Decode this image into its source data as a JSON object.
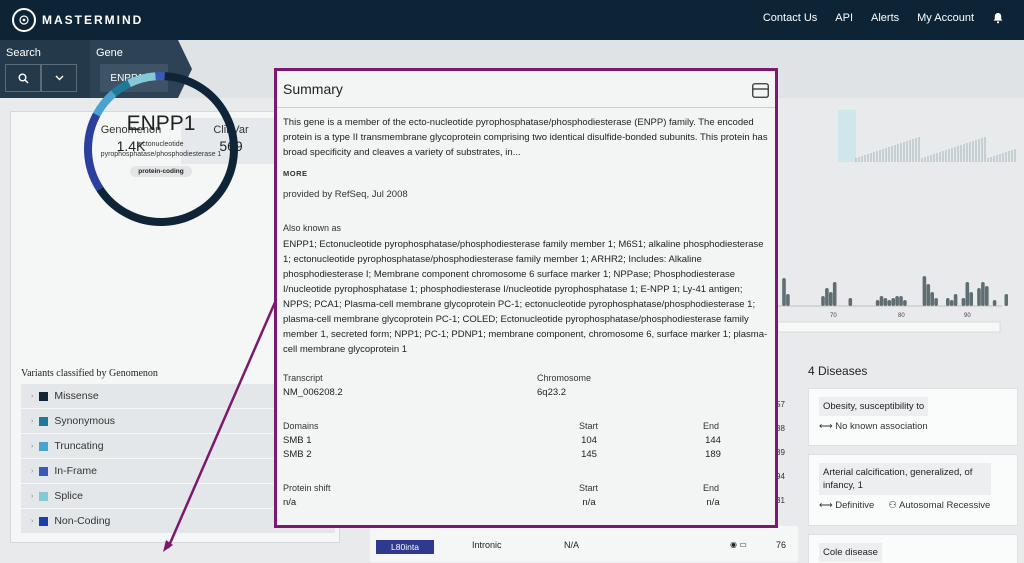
{
  "topbar": {
    "logo_text": "MASTERMIND",
    "nav": [
      "Contact Us",
      "API",
      "Alerts",
      "My Account"
    ]
  },
  "searchbar": {
    "search_label": "Search",
    "gene_label": "Gene",
    "gene_chip": "ENPP1",
    "gene_chip_close": "✕"
  },
  "left_panel": {
    "counts": [
      {
        "label": "Genomenon",
        "value": "1.4K"
      },
      {
        "label": "ClinVar",
        "value": "569"
      }
    ],
    "gene_symbol": "ENPP1",
    "gene_description": "ectonucleotide pyrophosphatase/phosphodiesterase 1",
    "gene_badge": "protein-coding",
    "variants_title": "Variants classified by Genomenon",
    "variant_types": [
      {
        "label": "Missense",
        "color": "#0f2537"
      },
      {
        "label": "Synonymous",
        "color": "#1f7a98"
      },
      {
        "label": "Truncating",
        "color": "#4aa3cf"
      },
      {
        "label": "In-Frame",
        "color": "#3a5ab7"
      },
      {
        "label": "Splice",
        "color": "#86c9d6"
      },
      {
        "label": "Non-Coding",
        "color": "#1c3ea8"
      }
    ],
    "donut_segments": [
      {
        "color": "#0f2537",
        "value": 0.65
      },
      {
        "color": "#2a3f9e",
        "value": 0.17
      },
      {
        "color": "#4aa3cf",
        "value": 0.06
      },
      {
        "color": "#1f7a98",
        "value": 0.04
      },
      {
        "color": "#86c9d6",
        "value": 0.06
      },
      {
        "color": "#3a5ab7",
        "value": 0.02
      }
    ]
  },
  "popup": {
    "title": "Summary",
    "summary": "This gene is a member of the ecto-nucleotide pyrophosphatase/phosphodiesterase (ENPP) family. The encoded protein is a type II transmembrane glycoprotein comprising two identical disulfide-bonded subunits. This protein has broad specificity and cleaves a variety of substrates, in...",
    "more": "MORE",
    "provided_by": "provided by RefSeq, Jul 2008",
    "aka_label": "Also known as",
    "aka": "ENPP1; Ectonucleotide pyrophosphatase/phosphodiesterase family member 1; M6S1; alkaline phosphodiesterase 1; ectonucleotide pyrophosphatase/phosphodiesterase family member 1; ARHR2; Includes: Alkaline phosphodiesterase I; Membrane component chromosome 6 surface marker 1; NPPase; Phosphodiesterase I/nucleotide pyrophosphatase 1; phosphodiesterase I/nucleotide pyrophosphatase 1; E-NPP 1; Ly-41 antigen; NPPS; PCA1; Plasma-cell membrane glycoprotein PC-1; ectonucleotide pyrophosphatase/phosphodiesterase 1; plasma-cell membrane glycoprotein PC-1; COLED; Ectonucleotide pyrophosphatase/phosphodiesterase family member 1, secreted form; NPP1; PC-1; PDNP1; membrane component, chromosome 6, surface marker 1; plasma-cell membrane glycoprotein 1",
    "transcript_label": "Transcript",
    "transcript": "NM_006208.2",
    "chromosome_label": "Chromosome",
    "chromosome": "6q23.2",
    "domains_label": "Domains",
    "start_label": "Start",
    "end_label": "End",
    "domains": [
      {
        "name": "SMB 1",
        "start": "104",
        "end": "144"
      },
      {
        "name": "SMB 2",
        "start": "145",
        "end": "189"
      }
    ],
    "protein_shift_label": "Protein shift",
    "protein_shift": {
      "name": "n/a",
      "start": "n/a",
      "end": "n/a"
    }
  },
  "diseases": {
    "title": "4 Diseases",
    "items": [
      {
        "name": "Obesity, susceptibility to",
        "association": "No known association",
        "inheritance": ""
      },
      {
        "name": "Arterial calcification, generalized, of infancy, 1",
        "association": "Definitive",
        "inheritance": "Autosomal Recessive"
      },
      {
        "name": "Cole disease",
        "association": "",
        "inheritance": ""
      }
    ]
  },
  "variant_row": {
    "variant": "L80inta",
    "type": "Intronic",
    "value": "N/A",
    "count": "76"
  },
  "edge_numbers": [
    "57",
    "38",
    "39",
    "94",
    "31"
  ],
  "axis_ticks": [
    "70",
    "80",
    "90"
  ]
}
